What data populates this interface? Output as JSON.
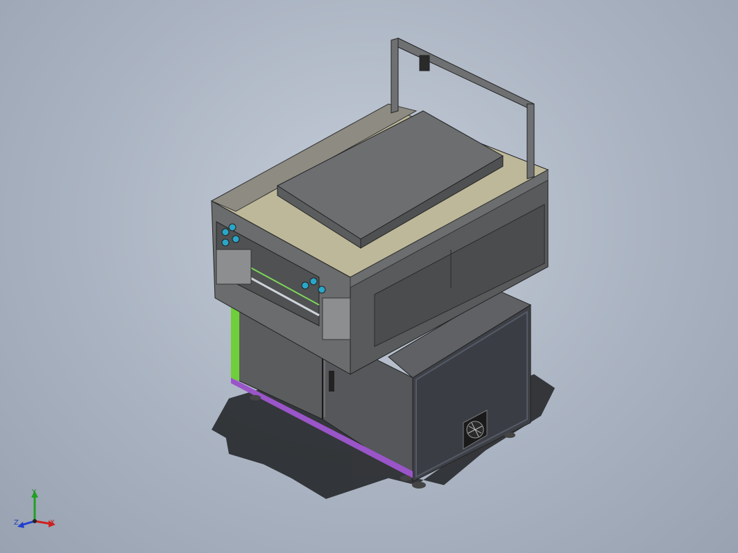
{
  "viewport": {
    "background_color": "#aab3c1",
    "triad": {
      "y_label": "Y",
      "z_label": "Z",
      "x_label": "X",
      "colors": {
        "x": "#d02020",
        "y": "#20a020",
        "z": "#2040d0"
      }
    }
  }
}
